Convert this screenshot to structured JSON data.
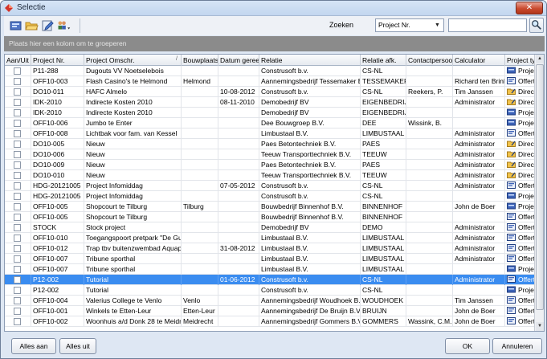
{
  "window": {
    "title": "Selectie",
    "close_label": "✕"
  },
  "toolbar": {
    "buttons": [
      {
        "name": "new-selection-icon"
      },
      {
        "name": "open-folder-icon"
      },
      {
        "name": "edit-icon"
      },
      {
        "name": "users-dropdown-icon"
      }
    ],
    "search_label": "Zoeken",
    "search_field_selected": "Project Nr.",
    "search_value": ""
  },
  "group_panel": {
    "text": "Plaats hier een kolom om te groeperen"
  },
  "grid": {
    "columns": [
      {
        "key": "aan",
        "label": "Aan/Uit"
      },
      {
        "key": "nr",
        "label": "Project Nr."
      },
      {
        "key": "omschr",
        "label": "Project Omschr."
      },
      {
        "key": "bouwplaats",
        "label": "Bouwplaats"
      },
      {
        "key": "datum",
        "label": "Datum gereed"
      },
      {
        "key": "relatie",
        "label": "Relatie"
      },
      {
        "key": "afk",
        "label": "Relatie afk."
      },
      {
        "key": "contact",
        "label": "Contactpersoon"
      },
      {
        "key": "calculator",
        "label": "Calculator"
      },
      {
        "key": "type",
        "label": "Project type"
      }
    ],
    "rows": [
      {
        "nr": "P11-288",
        "omschr": "Dugouts VV Noetselebois",
        "bouwplaats": "",
        "datum": "",
        "relatie": "Construsoft b.v.",
        "afk": "CS-NL",
        "contact": "",
        "calculator": "",
        "type": "Proje",
        "icon": "project"
      },
      {
        "nr": "OFF10-003",
        "omschr": "Flash Casino's te Helmond",
        "bouwplaats": "Helmond",
        "datum": "",
        "relatie": "Aannemingsbedrijf Tessemaker B.V.",
        "afk": "TESSEMAKER",
        "contact": "",
        "calculator": "Richard ten Brinke",
        "type": "Offert",
        "icon": "offer"
      },
      {
        "nr": "DO10-011",
        "omschr": "HAFC Almelo",
        "bouwplaats": "",
        "datum": "10-08-2012",
        "relatie": "Construsoft b.v.",
        "afk": "CS-NL",
        "contact": "Reekers, P.",
        "calculator": "Tim Janssen",
        "type": "Direc",
        "icon": "direct"
      },
      {
        "nr": "IDK-2010",
        "omschr": "Indirecte Kosten 2010",
        "bouwplaats": "",
        "datum": "08-11-2010",
        "relatie": "Demobedrijf BV",
        "afk": "EIGENBEDRIJF",
        "contact": "",
        "calculator": "Administrator",
        "type": "Direc",
        "icon": "direct"
      },
      {
        "nr": "IDK-2010",
        "omschr": "Indirecte Kosten 2010",
        "bouwplaats": "",
        "datum": "",
        "relatie": "Demobedrijf BV",
        "afk": "EIGENBEDRIJF",
        "contact": "",
        "calculator": "",
        "type": "Proje",
        "icon": "project"
      },
      {
        "nr": "OFF10-006",
        "omschr": "Jumbo te Enter",
        "bouwplaats": "",
        "datum": "",
        "relatie": "Dee Bouwgroep B.V.",
        "afk": "DEE",
        "contact": "Wissink, B.",
        "calculator": "",
        "type": "Proje",
        "icon": "project"
      },
      {
        "nr": "OFF10-008",
        "omschr": "Lichtbak voor fam. van Kessel",
        "bouwplaats": "",
        "datum": "",
        "relatie": "Limbustaal B.V.",
        "afk": "LIMBUSTAAL",
        "contact": "",
        "calculator": "Administrator",
        "type": "Offert",
        "icon": "offer"
      },
      {
        "nr": "DO10-005",
        "omschr": "Nieuw",
        "bouwplaats": "",
        "datum": "",
        "relatie": "Paes Betontechniek B.V.",
        "afk": "PAES",
        "contact": "",
        "calculator": "Administrator",
        "type": "Direc",
        "icon": "direct"
      },
      {
        "nr": "DO10-006",
        "omschr": "Nieuw",
        "bouwplaats": "",
        "datum": "",
        "relatie": "Teeuw Transporttechniek B.V.",
        "afk": "TEEUW",
        "contact": "",
        "calculator": "Administrator",
        "type": "Direc",
        "icon": "direct"
      },
      {
        "nr": "DO10-009",
        "omschr": "Nieuw",
        "bouwplaats": "",
        "datum": "",
        "relatie": "Paes Betontechniek B.V.",
        "afk": "PAES",
        "contact": "",
        "calculator": "Administrator",
        "type": "Direc",
        "icon": "direct"
      },
      {
        "nr": "DO10-010",
        "omschr": "Nieuw",
        "bouwplaats": "",
        "datum": "",
        "relatie": "Teeuw Transporttechniek B.V.",
        "afk": "TEEUW",
        "contact": "",
        "calculator": "Administrator",
        "type": "Direc",
        "icon": "direct"
      },
      {
        "nr": "HDG-20121005",
        "omschr": "Project Infomiddag",
        "bouwplaats": "",
        "datum": "07-05-2012",
        "relatie": "Construsoft b.v.",
        "afk": "CS-NL",
        "contact": "",
        "calculator": "Administrator",
        "type": "Offert",
        "icon": "offer"
      },
      {
        "nr": "HDG-20121005",
        "omschr": "Project Infomiddag",
        "bouwplaats": "",
        "datum": "",
        "relatie": "Construsoft b.v.",
        "afk": "CS-NL",
        "contact": "",
        "calculator": "",
        "type": "Proje",
        "icon": "project"
      },
      {
        "nr": "OFF10-005",
        "omschr": "Shopcourt te Tilburg",
        "bouwplaats": "Tilburg",
        "datum": "",
        "relatie": "Bouwbedrijf Binnenhof B.V.",
        "afk": "BINNENHOF",
        "contact": "",
        "calculator": "John de Boer",
        "type": "Proje",
        "icon": "project"
      },
      {
        "nr": "OFF10-005",
        "omschr": "Shopcourt te Tilburg",
        "bouwplaats": "",
        "datum": "",
        "relatie": "Bouwbedrijf Binnenhof B.V.",
        "afk": "BINNENHOF",
        "contact": "",
        "calculator": "",
        "type": "Offert",
        "icon": "offer"
      },
      {
        "nr": "STOCK",
        "omschr": "Stock project",
        "bouwplaats": "",
        "datum": "",
        "relatie": "Demobedrijf BV",
        "afk": "DEMO",
        "contact": "",
        "calculator": "Administrator",
        "type": "Offert",
        "icon": "offer"
      },
      {
        "nr": "OFF10-010",
        "omschr": "Toegangspoort pretpark \"De Gulle",
        "bouwplaats": "",
        "datum": "",
        "relatie": "Limbustaal B.V.",
        "afk": "LIMBUSTAAL",
        "contact": "",
        "calculator": "Administrator",
        "type": "Offert",
        "icon": "offer"
      },
      {
        "nr": "OFF10-012",
        "omschr": "Trap tbv buitenzwembad Aquapark",
        "bouwplaats": "",
        "datum": "31-08-2012",
        "relatie": "Limbustaal B.V.",
        "afk": "LIMBUSTAAL",
        "contact": "",
        "calculator": "Administrator",
        "type": "Offert",
        "icon": "offer"
      },
      {
        "nr": "OFF10-007",
        "omschr": "Tribune sporthal",
        "bouwplaats": "",
        "datum": "",
        "relatie": "Limbustaal B.V.",
        "afk": "LIMBUSTAAL",
        "contact": "",
        "calculator": "Administrator",
        "type": "Offert",
        "icon": "offer"
      },
      {
        "nr": "OFF10-007",
        "omschr": "Tribune sporthal",
        "bouwplaats": "",
        "datum": "",
        "relatie": "Limbustaal B.V.",
        "afk": "LIMBUSTAAL",
        "contact": "",
        "calculator": "",
        "type": "Proje",
        "icon": "project"
      },
      {
        "nr": "P12-002",
        "omschr": "Tutorial",
        "bouwplaats": "",
        "datum": "01-06-2012",
        "relatie": "Construsoft b.v.",
        "afk": "CS-NL",
        "contact": "",
        "calculator": "Administrator",
        "type": "Offert",
        "icon": "offer",
        "selected": true
      },
      {
        "nr": "P12-002",
        "omschr": "Tutorial",
        "bouwplaats": "",
        "datum": "",
        "relatie": "Construsoft b.v.",
        "afk": "CS-NL",
        "contact": "",
        "calculator": "",
        "type": "Proje",
        "icon": "project"
      },
      {
        "nr": "OFF10-004",
        "omschr": "Valerius College te Venlo",
        "bouwplaats": "Venlo",
        "datum": "",
        "relatie": "Aannemingsbedrijf Woudhoek B.V.",
        "afk": "WOUDHOEK",
        "contact": "",
        "calculator": "Tim Janssen",
        "type": "Offert",
        "icon": "offer"
      },
      {
        "nr": "OFF10-001",
        "omschr": "Winkels te Etten-Leur",
        "bouwplaats": "Etten-Leur",
        "datum": "",
        "relatie": "Aannemingsbedrijf De Bruijn B.V.",
        "afk": "BRUIJN",
        "contact": "",
        "calculator": "John de Boer",
        "type": "Offert",
        "icon": "offer"
      },
      {
        "nr": "OFF10-002",
        "omschr": "Woonhuis a/d Donk 28 te Meidreck",
        "bouwplaats": "Meidrecht",
        "datum": "",
        "relatie": "Aannemingsbedrijf Gommers B.V.",
        "afk": "GOMMERS",
        "contact": "Wassink, C.M.F.",
        "calculator": "John de Boer",
        "type": "Offert",
        "icon": "offer"
      }
    ]
  },
  "footer": {
    "select_all": "Alles aan",
    "select_none": "Alles uit",
    "ok": "OK",
    "cancel": "Annuleren"
  },
  "colors": {
    "selection": "#3a8cf0",
    "close_button": "#c94a2f",
    "group_panel": "#8b8b8b"
  }
}
